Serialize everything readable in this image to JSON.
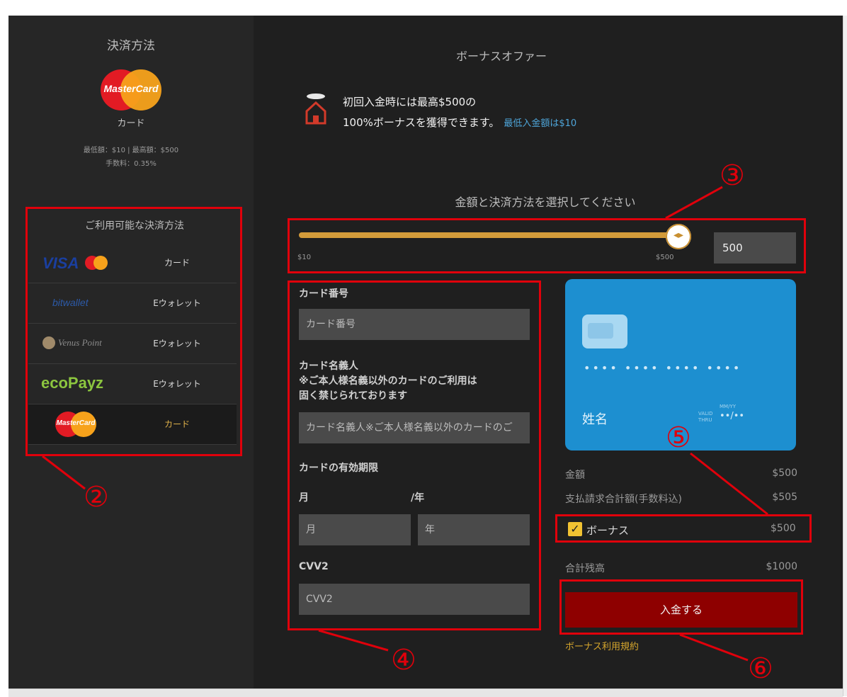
{
  "sidebar": {
    "title": "決済方法",
    "selected_method": {
      "logo_text": "MasterCard",
      "label": "カード"
    },
    "limits": "最低額：$10 | 最高額：$500",
    "fee": "手数料：0.35%",
    "available_title": "ご利用可能な決済方法",
    "methods": [
      {
        "logo": "VISA",
        "logo_icon": "visa-mastercard-logo",
        "label": "カード"
      },
      {
        "logo": "bitwallet",
        "logo_icon": "bitwallet-logo",
        "label": "Eウォレット"
      },
      {
        "logo": "Venus Point",
        "logo_icon": "venus-point-logo",
        "label": "Eウォレット"
      },
      {
        "logo": "ecoPayz",
        "logo_icon": "ecopayz-logo",
        "label": "Eウォレット"
      },
      {
        "logo": "MasterCard",
        "logo_icon": "mastercard-logo",
        "label": "カード",
        "selected": true
      }
    ]
  },
  "bonus": {
    "title": "ボーナスオファー",
    "line1": "初回入金時には最高$500の",
    "line2": "100%ボーナスを獲得できます。",
    "min_deposit": "最低入金額は$10"
  },
  "amount": {
    "title": "金額と決済方法を選択してください",
    "slider_min": "$10",
    "slider_max": "$500",
    "slider_fraction": 1.0,
    "value": "500"
  },
  "form": {
    "card_number_label": "カード番号",
    "card_number_placeholder": "カード番号",
    "holder_label_1": "カード名義人",
    "holder_label_2": "※ご本人様名義以外のカードのご利用は",
    "holder_label_3": "固く禁じられております",
    "holder_placeholder": "カード名義人※ご本人様名義以外のカードのご",
    "expiry_label": "カードの有効期限",
    "month_label": "月",
    "year_label": "/年",
    "month_placeholder": "月",
    "year_placeholder": "年",
    "cvv_label": "CVV2",
    "cvv_placeholder": "CVV2"
  },
  "card_preview": {
    "number": "•••• •••• •••• ••••",
    "name": "姓名",
    "valid_thru": "VALID\nTHRU",
    "mmyy": "MM/YY",
    "expiry": "••/••"
  },
  "summary": {
    "amount_label": "金額",
    "amount_value": "$500",
    "total_due_label": "支払請求合計額(手数料込)",
    "total_due_value": "$505",
    "bonus_label": "ボーナス",
    "bonus_value": "$500",
    "bonus_checked": true,
    "balance_label": "合計残高",
    "balance_value": "$1000"
  },
  "actions": {
    "deposit_label": "入金する",
    "terms_label": "ボーナス利用規約"
  },
  "annotations": [
    "②",
    "③",
    "④",
    "⑤",
    "⑥"
  ],
  "colors": {
    "accent_red": "#e0000b",
    "button_red": "#8e0000",
    "slider_gold": "#d39b3a",
    "card_blue": "#1d8fd0",
    "link_gold": "#d6a62d"
  }
}
